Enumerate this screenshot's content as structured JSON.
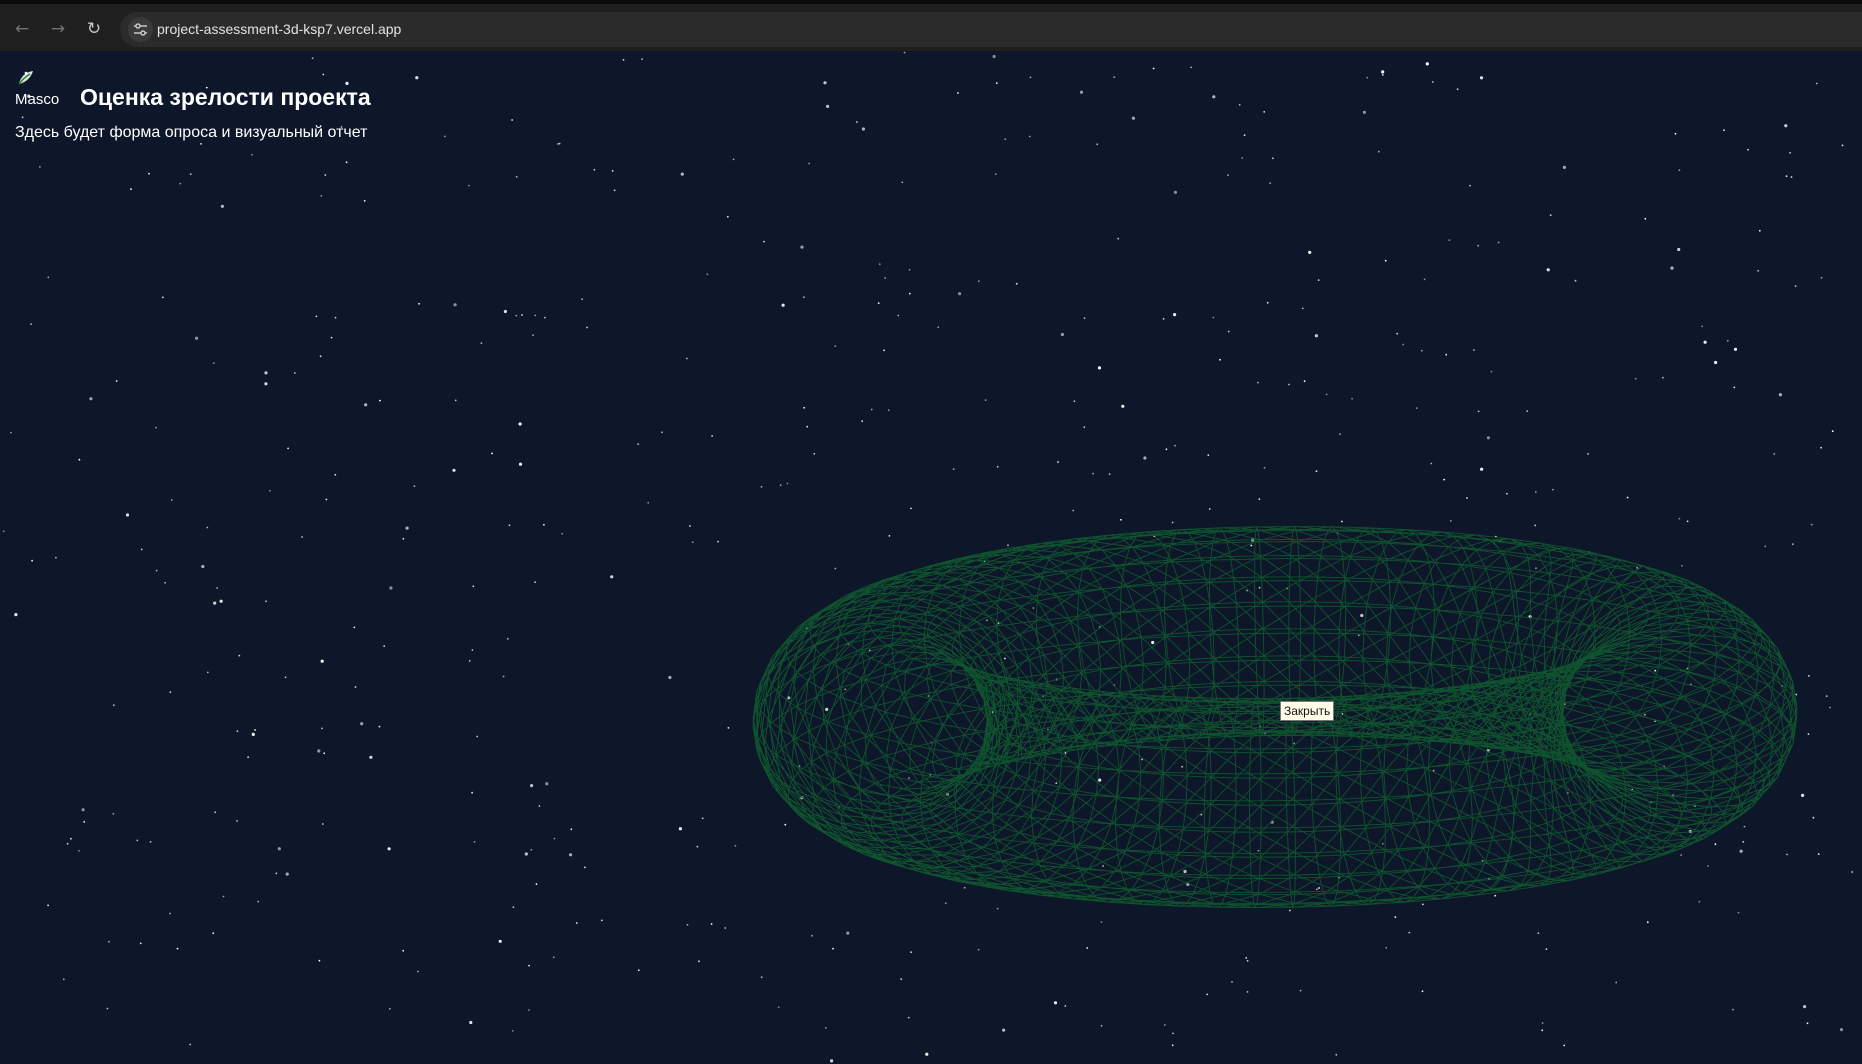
{
  "browser": {
    "url": "project-assessment-3d-ksp7.vercel.app",
    "back_icon": "arrow-left",
    "forward_icon": "arrow-right",
    "reload_icon": "reload",
    "site_info_icon": "tune-sliders"
  },
  "header": {
    "logo_text": "Masco",
    "title": "Оценка зрелости проекта",
    "subtitle": "Здесь будет форма опроса и визуальный отчет"
  },
  "scene": {
    "object": "wireframe-torus",
    "wire_color": "#0f5a2f",
    "background_color": "#0d1729",
    "star_color": "#ffffff"
  },
  "tooltip": {
    "text": "Закрыть"
  }
}
